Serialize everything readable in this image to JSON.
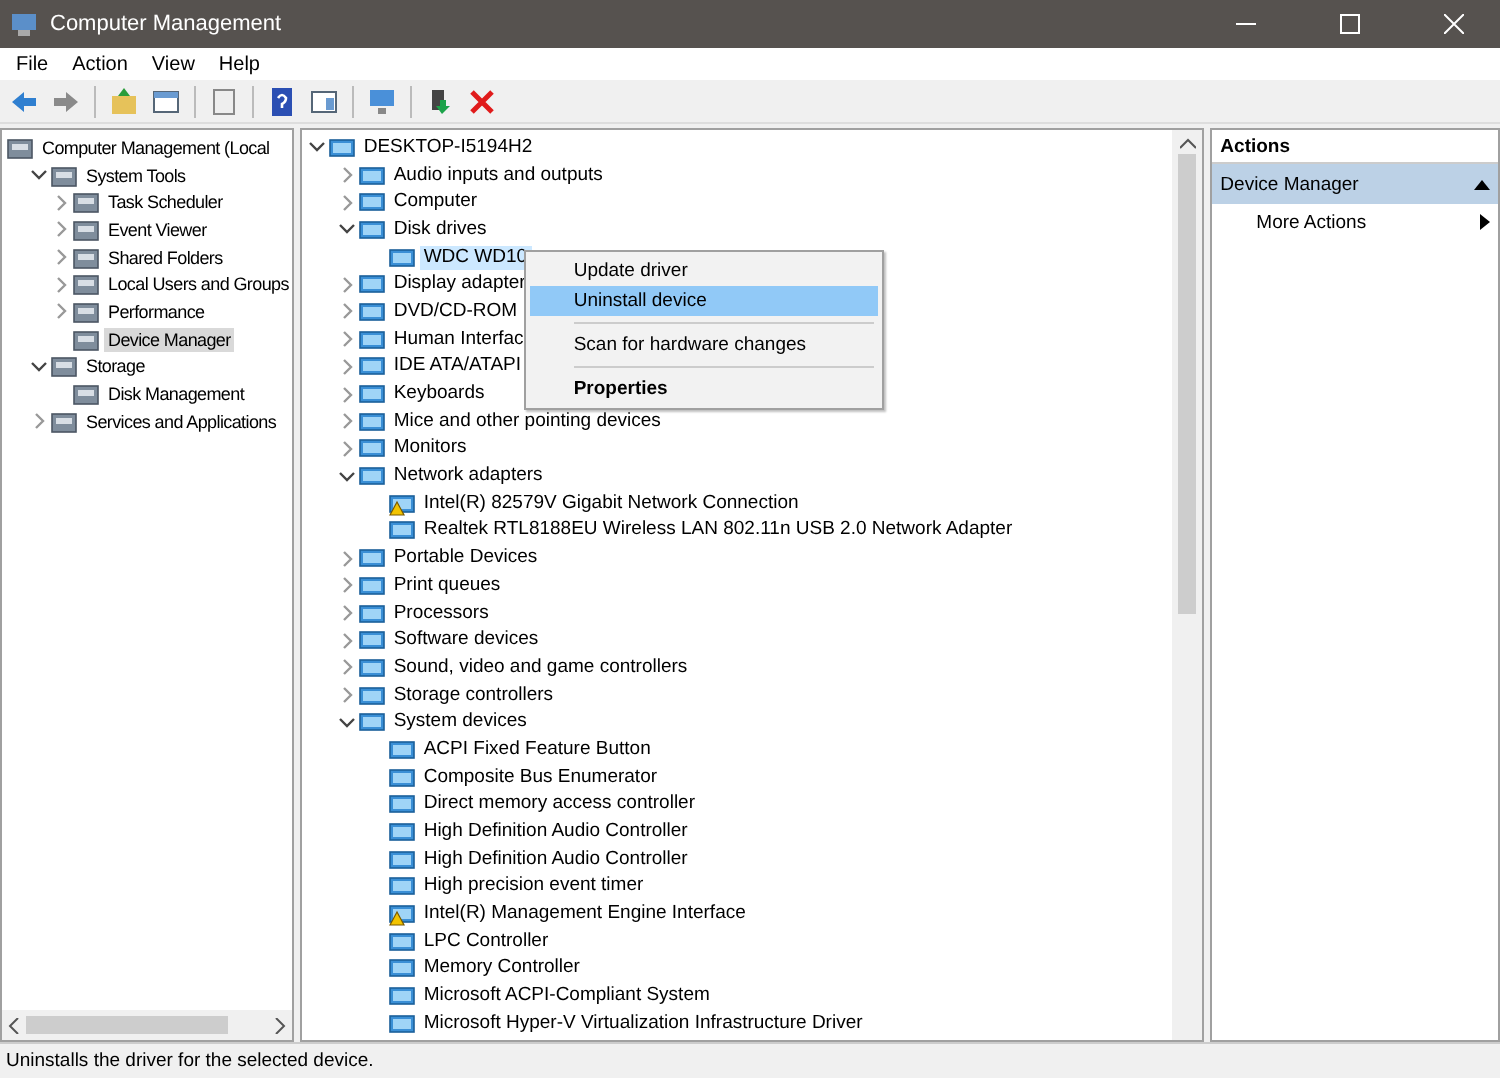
{
  "window": {
    "title": "Computer Management"
  },
  "menu_bar": [
    "File",
    "Action",
    "View",
    "Help"
  ],
  "left_tree": [
    {
      "label": "Computer Management (Local",
      "selected": false,
      "children": [
        {
          "label": "System Tools",
          "expanded": true,
          "selected": false,
          "children": [
            {
              "label": "Task Scheduler",
              "expanded": false,
              "selected": false
            },
            {
              "label": "Event Viewer",
              "expanded": false,
              "selected": false
            },
            {
              "label": "Shared Folders",
              "expanded": false,
              "selected": false
            },
            {
              "label": "Local Users and Groups",
              "expanded": false,
              "selected": false
            },
            {
              "label": "Performance",
              "expanded": false,
              "selected": false
            },
            {
              "label": "Device Manager",
              "selected": true
            }
          ]
        },
        {
          "label": "Storage",
          "expanded": true,
          "selected": false,
          "children": [
            {
              "label": "Disk Management",
              "selected": false
            }
          ]
        },
        {
          "label": "Services and Applications",
          "expanded": false,
          "selected": false
        }
      ]
    }
  ],
  "device_tree": [
    {
      "label": "DESKTOP-I5194H2",
      "expanded": true,
      "selected": false,
      "children": [
        {
          "label": "Audio inputs and outputs",
          "expanded": false,
          "selected": false
        },
        {
          "label": "Computer",
          "expanded": false,
          "selected": false
        },
        {
          "label": "Disk drives",
          "expanded": true,
          "selected": false,
          "children": [
            {
              "label": "WDC WD10",
              "selected": true
            }
          ]
        },
        {
          "label": "Display adapter",
          "expanded": false,
          "selected": false
        },
        {
          "label": "DVD/CD-ROM",
          "expanded": false,
          "selected": false
        },
        {
          "label": "Human Interfac",
          "expanded": false,
          "selected": false
        },
        {
          "label": "IDE ATA/ATAPI",
          "expanded": false,
          "selected": false
        },
        {
          "label": "Keyboards",
          "expanded": false,
          "selected": false
        },
        {
          "label": "Mice and other pointing devices",
          "expanded": false,
          "selected": false
        },
        {
          "label": "Monitors",
          "expanded": false,
          "selected": false
        },
        {
          "label": "Network adapters",
          "expanded": true,
          "selected": false,
          "children": [
            {
              "label": "Intel(R) 82579V Gigabit Network Connection",
              "selected": false,
              "warning": true
            },
            {
              "label": "Realtek RTL8188EU Wireless LAN 802.11n USB 2.0 Network Adapter",
              "selected": false,
              "warning": false
            }
          ]
        },
        {
          "label": "Portable Devices",
          "expanded": false,
          "selected": false
        },
        {
          "label": "Print queues",
          "expanded": false,
          "selected": false
        },
        {
          "label": "Processors",
          "expanded": false,
          "selected": false
        },
        {
          "label": "Software devices",
          "expanded": false,
          "selected": false
        },
        {
          "label": "Sound, video and game controllers",
          "expanded": false,
          "selected": false
        },
        {
          "label": "Storage controllers",
          "expanded": false,
          "selected": false
        },
        {
          "label": "System devices",
          "expanded": true,
          "selected": false,
          "children": [
            {
              "label": "ACPI Fixed Feature Button",
              "selected": false,
              "warning": false
            },
            {
              "label": "Composite Bus Enumerator",
              "selected": false,
              "warning": false
            },
            {
              "label": "Direct memory access controller",
              "selected": false,
              "warning": false
            },
            {
              "label": "High Definition Audio Controller",
              "selected": false,
              "warning": false
            },
            {
              "label": "High Definition Audio Controller",
              "selected": false,
              "warning": false
            },
            {
              "label": "High precision event timer",
              "selected": false,
              "warning": false
            },
            {
              "label": "Intel(R) Management Engine Interface",
              "selected": false,
              "warning": true
            },
            {
              "label": "LPC Controller",
              "selected": false,
              "warning": false
            },
            {
              "label": "Memory Controller",
              "selected": false,
              "warning": false
            },
            {
              "label": "Microsoft ACPI-Compliant System",
              "selected": false,
              "warning": false
            },
            {
              "label": "Microsoft Hyper-V Virtualization Infrastructure Driver",
              "selected": false,
              "warning": false
            }
          ]
        }
      ]
    }
  ],
  "context_menu": [
    {
      "kind": "item",
      "label": "Update driver",
      "selected": false,
      "default": false
    },
    {
      "kind": "item",
      "label": "Uninstall device",
      "selected": true,
      "default": false
    },
    {
      "kind": "separator"
    },
    {
      "kind": "item",
      "label": "Scan for hardware changes",
      "selected": false,
      "default": false
    },
    {
      "kind": "separator"
    },
    {
      "kind": "item",
      "label": "Properties",
      "selected": false,
      "default": true
    }
  ],
  "actions": {
    "header": "Actions",
    "section": "Device Manager",
    "items": [
      "More Actions"
    ]
  },
  "status_bar": "Uninstalls the driver for the selected device."
}
